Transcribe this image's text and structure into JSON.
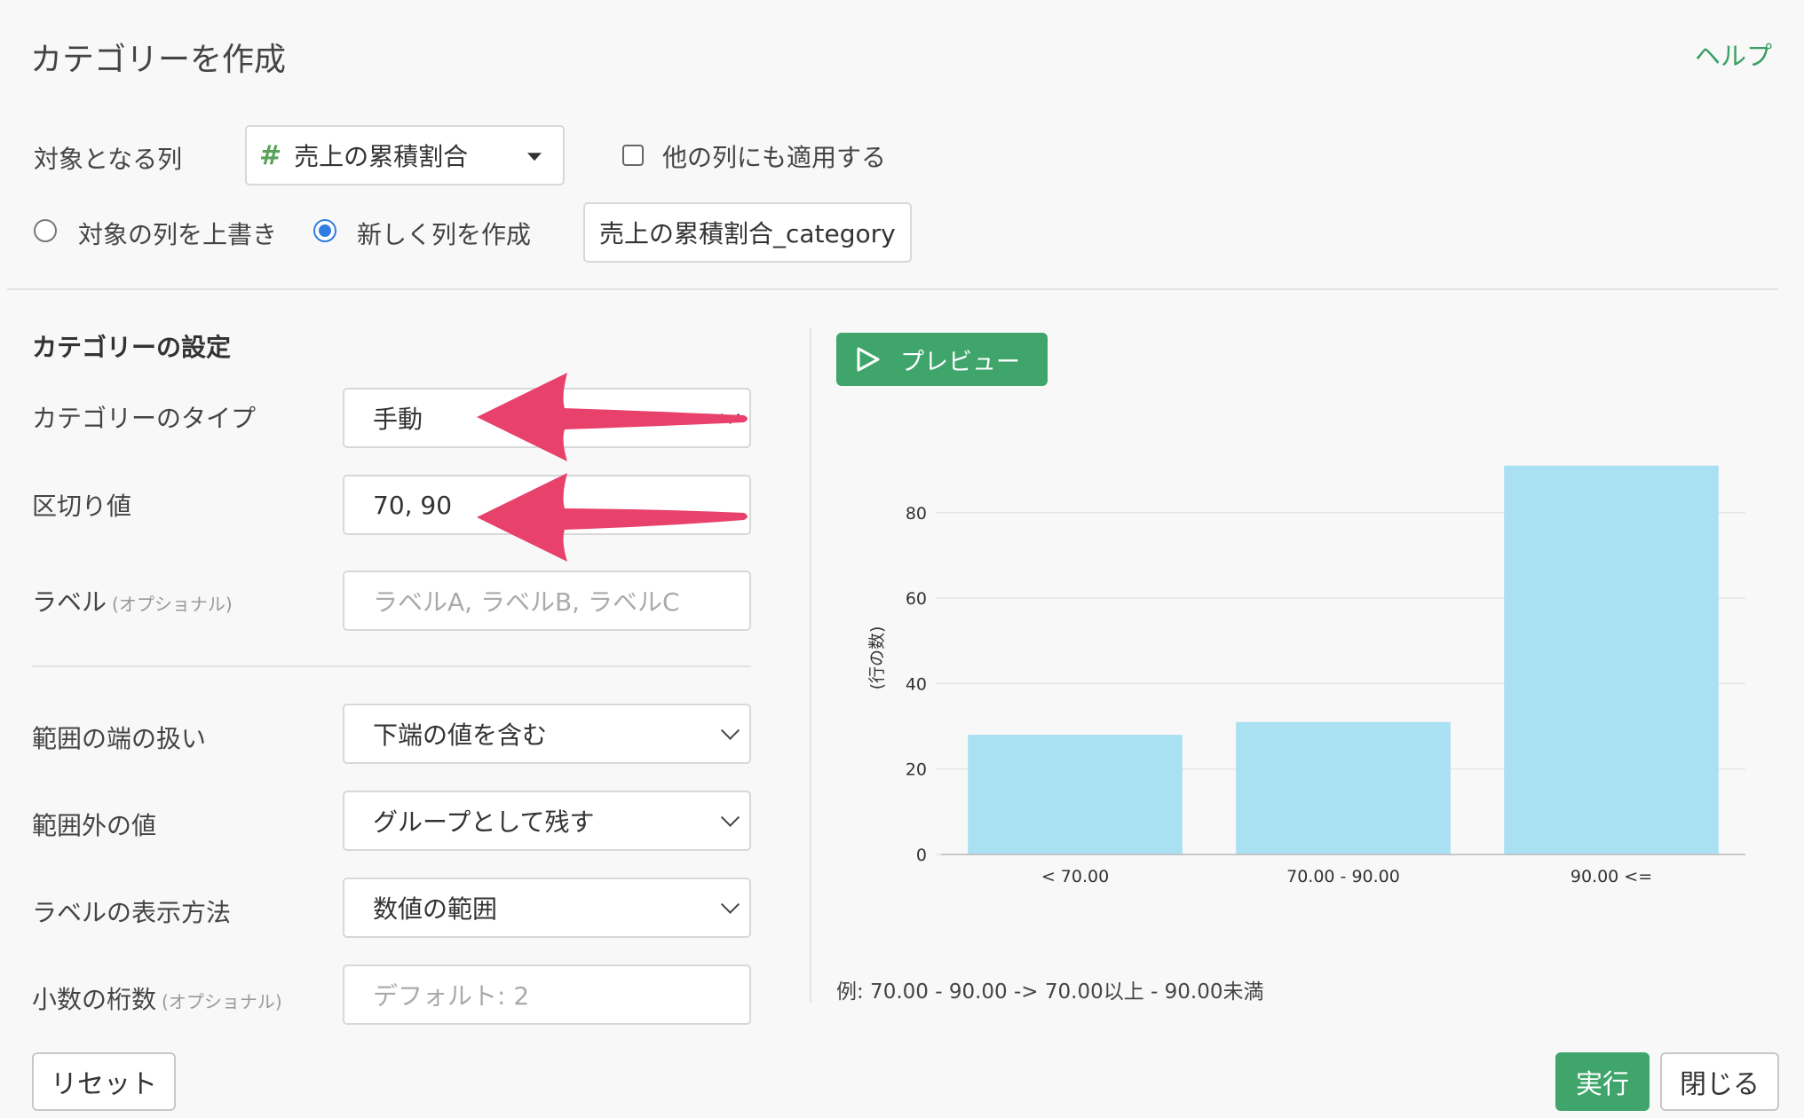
{
  "header": {
    "title": "カテゴリーを作成",
    "help": "ヘルプ"
  },
  "target": {
    "label": "対象となる列",
    "column": "売上の累積割合",
    "apply_others": "他の列にも適用する",
    "overwrite": "対象の列を上書き",
    "create_new": "新しく列を作成",
    "new_column_name": "売上の累積割合_category"
  },
  "settings": {
    "title": "カテゴリーの設定",
    "type_label": "カテゴリーのタイプ",
    "type_value": "手動",
    "cut_label": "区切り値",
    "cut_value": "70, 90",
    "label_label": "ラベル",
    "label_optional": "(オプショナル)",
    "label_placeholder": "ラベルA, ラベルB, ラベルC",
    "edge_label": "範囲の端の扱い",
    "edge_value": "下端の値を含む",
    "outside_label": "範囲外の値",
    "outside_value": "グループとして残す",
    "display_label": "ラベルの表示方法",
    "display_value": "数値の範囲",
    "decimal_label": "小数の桁数",
    "decimal_optional": "(オプショナル)",
    "decimal_placeholder": "デフォルト: 2"
  },
  "preview": {
    "button": "プレビュー",
    "note": "例: 70.00 - 90.00 -> 70.00以上 - 90.00未満"
  },
  "footer": {
    "reset": "リセット",
    "run": "実行",
    "close": "閉じる"
  },
  "colors": {
    "accent": "#3fa56b",
    "bar": "#a9e0f2",
    "arrow": "#e8416b",
    "radio": "#2f7de1"
  },
  "chart_data": {
    "type": "bar",
    "categories": [
      "< 70.00",
      "70.00 - 90.00",
      "90.00 <="
    ],
    "values": [
      28,
      31,
      91
    ],
    "ylabel": "(行の数)",
    "yticks": [
      0,
      20,
      40,
      60,
      80
    ],
    "ylim": [
      0,
      92
    ],
    "grid": true
  }
}
